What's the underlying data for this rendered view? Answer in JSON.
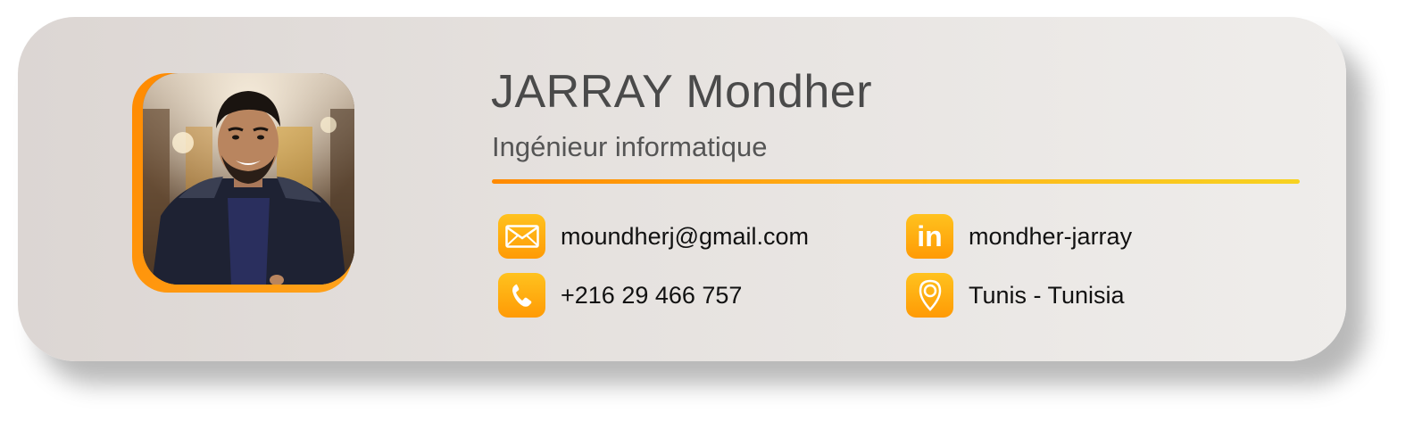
{
  "profile": {
    "name": "JARRAY Mondher",
    "title": "Ingénieur informatique"
  },
  "contacts": {
    "email": {
      "icon": "envelope-icon",
      "value": "moundherj@gmail.com"
    },
    "phone": {
      "icon": "phone-icon",
      "value": "+216 29 466 757"
    },
    "linkedin": {
      "icon": "linkedin-icon",
      "label": "in",
      "value": "mondher-jarray"
    },
    "location": {
      "icon": "location-pin-icon",
      "value": "Tunis - Tunisia"
    }
  },
  "colors": {
    "accent_orange": "#ff8a00",
    "accent_yellow": "#f7d221",
    "card_background": "#e6e2df",
    "name_text": "#4a4a4a"
  }
}
